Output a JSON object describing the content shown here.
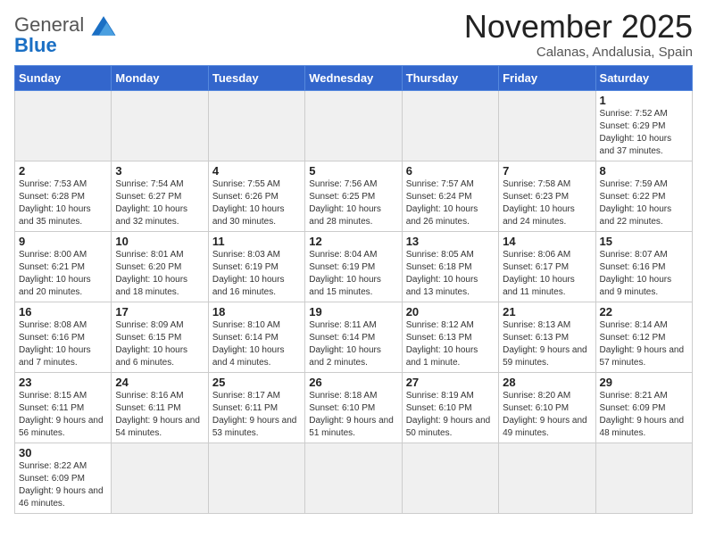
{
  "logo": {
    "general": "General",
    "blue": "Blue"
  },
  "title": "November 2025",
  "subtitle": "Calanas, Andalusia, Spain",
  "days_of_week": [
    "Sunday",
    "Monday",
    "Tuesday",
    "Wednesday",
    "Thursday",
    "Friday",
    "Saturday"
  ],
  "weeks": [
    [
      {
        "day": "",
        "info": "",
        "empty": true
      },
      {
        "day": "",
        "info": "",
        "empty": true
      },
      {
        "day": "",
        "info": "",
        "empty": true
      },
      {
        "day": "",
        "info": "",
        "empty": true
      },
      {
        "day": "",
        "info": "",
        "empty": true
      },
      {
        "day": "",
        "info": "",
        "empty": true
      },
      {
        "day": "1",
        "info": "Sunrise: 7:52 AM\nSunset: 6:29 PM\nDaylight: 10 hours and 37 minutes."
      }
    ],
    [
      {
        "day": "2",
        "info": "Sunrise: 7:53 AM\nSunset: 6:28 PM\nDaylight: 10 hours and 35 minutes."
      },
      {
        "day": "3",
        "info": "Sunrise: 7:54 AM\nSunset: 6:27 PM\nDaylight: 10 hours and 32 minutes."
      },
      {
        "day": "4",
        "info": "Sunrise: 7:55 AM\nSunset: 6:26 PM\nDaylight: 10 hours and 30 minutes."
      },
      {
        "day": "5",
        "info": "Sunrise: 7:56 AM\nSunset: 6:25 PM\nDaylight: 10 hours and 28 minutes."
      },
      {
        "day": "6",
        "info": "Sunrise: 7:57 AM\nSunset: 6:24 PM\nDaylight: 10 hours and 26 minutes."
      },
      {
        "day": "7",
        "info": "Sunrise: 7:58 AM\nSunset: 6:23 PM\nDaylight: 10 hours and 24 minutes."
      },
      {
        "day": "8",
        "info": "Sunrise: 7:59 AM\nSunset: 6:22 PM\nDaylight: 10 hours and 22 minutes."
      }
    ],
    [
      {
        "day": "9",
        "info": "Sunrise: 8:00 AM\nSunset: 6:21 PM\nDaylight: 10 hours and 20 minutes."
      },
      {
        "day": "10",
        "info": "Sunrise: 8:01 AM\nSunset: 6:20 PM\nDaylight: 10 hours and 18 minutes."
      },
      {
        "day": "11",
        "info": "Sunrise: 8:03 AM\nSunset: 6:19 PM\nDaylight: 10 hours and 16 minutes."
      },
      {
        "day": "12",
        "info": "Sunrise: 8:04 AM\nSunset: 6:19 PM\nDaylight: 10 hours and 15 minutes."
      },
      {
        "day": "13",
        "info": "Sunrise: 8:05 AM\nSunset: 6:18 PM\nDaylight: 10 hours and 13 minutes."
      },
      {
        "day": "14",
        "info": "Sunrise: 8:06 AM\nSunset: 6:17 PM\nDaylight: 10 hours and 11 minutes."
      },
      {
        "day": "15",
        "info": "Sunrise: 8:07 AM\nSunset: 6:16 PM\nDaylight: 10 hours and 9 minutes."
      }
    ],
    [
      {
        "day": "16",
        "info": "Sunrise: 8:08 AM\nSunset: 6:16 PM\nDaylight: 10 hours and 7 minutes."
      },
      {
        "day": "17",
        "info": "Sunrise: 8:09 AM\nSunset: 6:15 PM\nDaylight: 10 hours and 6 minutes."
      },
      {
        "day": "18",
        "info": "Sunrise: 8:10 AM\nSunset: 6:14 PM\nDaylight: 10 hours and 4 minutes."
      },
      {
        "day": "19",
        "info": "Sunrise: 8:11 AM\nSunset: 6:14 PM\nDaylight: 10 hours and 2 minutes."
      },
      {
        "day": "20",
        "info": "Sunrise: 8:12 AM\nSunset: 6:13 PM\nDaylight: 10 hours and 1 minute."
      },
      {
        "day": "21",
        "info": "Sunrise: 8:13 AM\nSunset: 6:13 PM\nDaylight: 9 hours and 59 minutes."
      },
      {
        "day": "22",
        "info": "Sunrise: 8:14 AM\nSunset: 6:12 PM\nDaylight: 9 hours and 57 minutes."
      }
    ],
    [
      {
        "day": "23",
        "info": "Sunrise: 8:15 AM\nSunset: 6:11 PM\nDaylight: 9 hours and 56 minutes."
      },
      {
        "day": "24",
        "info": "Sunrise: 8:16 AM\nSunset: 6:11 PM\nDaylight: 9 hours and 54 minutes."
      },
      {
        "day": "25",
        "info": "Sunrise: 8:17 AM\nSunset: 6:11 PM\nDaylight: 9 hours and 53 minutes."
      },
      {
        "day": "26",
        "info": "Sunrise: 8:18 AM\nSunset: 6:10 PM\nDaylight: 9 hours and 51 minutes."
      },
      {
        "day": "27",
        "info": "Sunrise: 8:19 AM\nSunset: 6:10 PM\nDaylight: 9 hours and 50 minutes."
      },
      {
        "day": "28",
        "info": "Sunrise: 8:20 AM\nSunset: 6:10 PM\nDaylight: 9 hours and 49 minutes."
      },
      {
        "day": "29",
        "info": "Sunrise: 8:21 AM\nSunset: 6:09 PM\nDaylight: 9 hours and 48 minutes."
      }
    ],
    [
      {
        "day": "30",
        "info": "Sunrise: 8:22 AM\nSunset: 6:09 PM\nDaylight: 9 hours and 46 minutes."
      },
      {
        "day": "",
        "info": "",
        "empty": true
      },
      {
        "day": "",
        "info": "",
        "empty": true
      },
      {
        "day": "",
        "info": "",
        "empty": true
      },
      {
        "day": "",
        "info": "",
        "empty": true
      },
      {
        "day": "",
        "info": "",
        "empty": true
      },
      {
        "day": "",
        "info": "",
        "empty": true
      }
    ]
  ]
}
